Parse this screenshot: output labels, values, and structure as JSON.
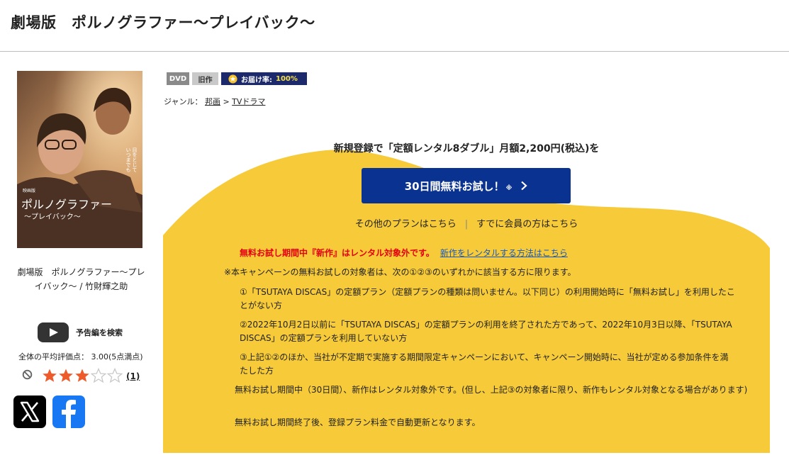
{
  "header": {
    "title": "劇場版　ポルノグラファー〜プレイバック〜"
  },
  "poster": {
    "tagline": "目をとじて\nいつまでも",
    "logo_small": "映画版",
    "logo_main": "ポルノグラファー",
    "logo_sub": "〜プレイバック〜"
  },
  "sidebar": {
    "caption": "劇場版　ポルノグラファー〜プレイバック〜 / 竹財輝之助",
    "trailer_label": "予告編を検索",
    "avg_rating": "全体の平均評価点：  3.00(5点満点)",
    "rating": 3,
    "rating_max": 5,
    "review_count": "(1)",
    "share": [
      {
        "name": "x",
        "icon": "x-logo-icon"
      },
      {
        "name": "facebook",
        "icon": "facebook-logo-icon"
      }
    ]
  },
  "badges": {
    "format": "DVD",
    "age": "旧作",
    "delivery_label": "お届け率:",
    "delivery_value": "100%"
  },
  "genre": {
    "label": "ジャンル：",
    "items": [
      "邦画",
      "TVドラマ"
    ],
    "separator": ">"
  },
  "promo": {
    "headline": "新規登録で「定額レンタル8ダブル」月額2,200円(税込)を",
    "button_label": "30日間無料お試し！",
    "button_note": "※",
    "other_plans": "その他のプランはこちら",
    "member_link": "すでに会員の方はこちら",
    "notice_red": "無料お試し期間中『新作』はレンタル対象外です。",
    "notice_link": "新作をレンタルする方法はこちら",
    "paragraph1": "※本キャンペーンの無料お試しの対象者は、次の①②③のいずれかに該当する方に限ります。",
    "conditions": [
      "①「TSUTAYA DISCAS」の定額プラン（定額プランの種類は問いません。以下同じ）の利用開始時に「無料お試し」を利用したことがない方",
      "②2022年10月2日以前に「TSUTAYA DISCAS」の定額プランの利用を終了された方であって、2022年10月3日以降、「TSUTAYA DISCAS」の定額プランを利用していない方",
      "③上記①②のほか、当社が不定期で実施する期間限定キャンペーンにおいて、キャンペーン開始時に、当社が定める参加条件を満たした方"
    ],
    "paragraph2": "無料お試し期間中（30日間）、新作はレンタル対象外です。(但し、上記③の対象者に限り、新作もレンタル対象となる場合があります)",
    "paragraph3": "無料お試し期間終了後、登録プラン料金で自動更新となります。"
  },
  "colors": {
    "brand_blue": "#0a3291",
    "promo_yellow": "#f6ca38",
    "notice_red": "#e60012",
    "star_orange": "#ef5a2a",
    "facebook_blue": "#1877f2"
  }
}
